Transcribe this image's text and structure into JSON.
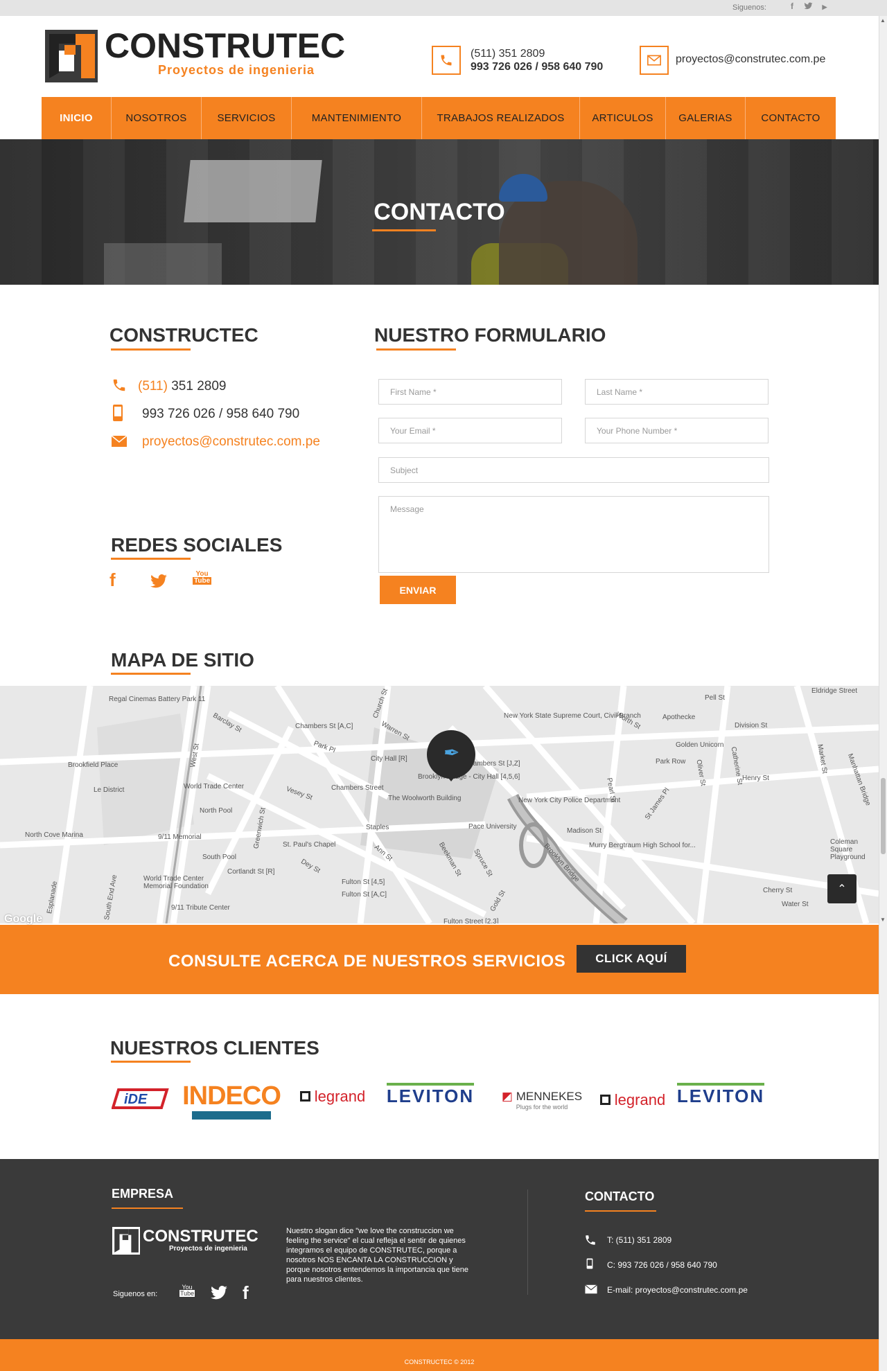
{
  "topbar": {
    "follow_label": "Siguenos:",
    "icons": [
      "facebook-icon",
      "twitter-icon",
      "youtube-icon"
    ]
  },
  "header": {
    "logo_name": "CONSTRUTEC",
    "logo_tagline": "Proyectos de ingenieria",
    "phone_line1": "(511) 351 2809",
    "phone_line2": "993 726 026 / 958 640 790",
    "email": "proyectos@construtec.com.pe"
  },
  "nav": {
    "items": [
      {
        "label": "INICIO",
        "active": true
      },
      {
        "label": "NOSOTROS"
      },
      {
        "label": "SERVICIOS"
      },
      {
        "label": "MANTENIMIENTO"
      },
      {
        "label": "TRABAJOS REALIZADOS"
      },
      {
        "label": "ARTICULOS"
      },
      {
        "label": "GALERIAS"
      },
      {
        "label": "CONTACTO"
      }
    ]
  },
  "hero": {
    "title": "CONTACTO"
  },
  "contact": {
    "title": "CONSTRUCTEC",
    "phone_prefix": "(511)",
    "phone": "351 2809",
    "mobile": "993 726 026 / 958 640 790",
    "email": "proyectos@construtec.com.pe"
  },
  "form": {
    "title": "NUESTRO FORMULARIO",
    "first_name_placeholder": "First Name *",
    "last_name_placeholder": "Last Name *",
    "email_placeholder": "Your Email *",
    "phone_placeholder": "Your Phone Number *",
    "subject_placeholder": "Subject",
    "message_placeholder": "Message",
    "send_label": "ENVIAR"
  },
  "social": {
    "title": "REDES SOCIALES"
  },
  "map_section": {
    "title": "MAPA DE SITIO"
  },
  "map": {
    "labels": [
      "Regal Cinemas Battery Park 11",
      "Chambers St [A,C]",
      "Warren St",
      "New York State Supreme Court, Civil Branch",
      "Worth St",
      "Apothecke",
      "Pell St",
      "Division St",
      "Eldridge Street",
      "Golden Unicorn",
      "Park Pl",
      "City Hall [R]",
      "Chambers St [J,Z]",
      "Brooklyn Bridge - City Hall [4,5,6]",
      "Park Row",
      "Henry St",
      "Brookfield Place",
      "World Trade Center",
      "Chambers Street",
      "The Woolworth Building",
      "Le District",
      "North Pool",
      "New York City Police Department",
      "Madison St",
      "Vesey St",
      "Staples",
      "Pace University",
      "Murry Bergtraum High School for...",
      "Coleman Square Playground",
      "North Cove Marina",
      "9/11 Memorial",
      "St. Paul's Chapel",
      "South Pool",
      "Cortlandt St [R]",
      "Dey St",
      "Ann St",
      "Fulton St [4,5]",
      "Fulton St [A,C]",
      "Cherry St",
      "Water St",
      "World Trade Center Memorial Foundation",
      "9/11 Tribute Center",
      "Fulton Street [2,3]",
      "Brooklyn Bridge",
      "Barclay St",
      "West St",
      "Church St",
      "Catherine St",
      "Oliver St",
      "Market St",
      "Pearl St",
      "St James Pl",
      "Spruce St",
      "Beekman St",
      "Gold St",
      "Greenwich St",
      "South End Ave",
      "Esplanade",
      "Manhattan Bridge"
    ],
    "google_label": "Google"
  },
  "cta": {
    "text": "CONSULTE ACERCA DE NUESTROS SERVICIOS",
    "button": "CLICK AQUÍ"
  },
  "clients": {
    "title": "NUESTROS CLIENTES",
    "logos": [
      "INDECO",
      "legrand",
      "LEVITON",
      "MENNEKES",
      "Plugs for the world",
      "legrand",
      "LEVITON"
    ]
  },
  "footer": {
    "empresa_title": "EMPRESA",
    "logo_name": "CONSTRUTEC",
    "logo_tagline": "Proyectos de ingenieria",
    "slogan": "Nuestro slogan dice \"we love the construccion we feeling the service\" el cual refleja el sentir de quienes integramos el equipo de CONSTRUTEC, porque a nosotros NOS ENCANTA LA CONSTRUCCION y porque nosotros entendemos la importancia que tiene para nuestros clientes.",
    "follow_label": "Siguenos en:",
    "contact_title": "CONTACTO",
    "phone": "T: (511) 351 2809",
    "mobile": "C: 993 726 026 / 958 640 790",
    "email": "E-mail: proyectos@construtec.com.pe",
    "copyright": "CONSTRUCTEC © 2012"
  },
  "colors": {
    "accent": "#f58220",
    "dark": "#3a3a3a"
  }
}
